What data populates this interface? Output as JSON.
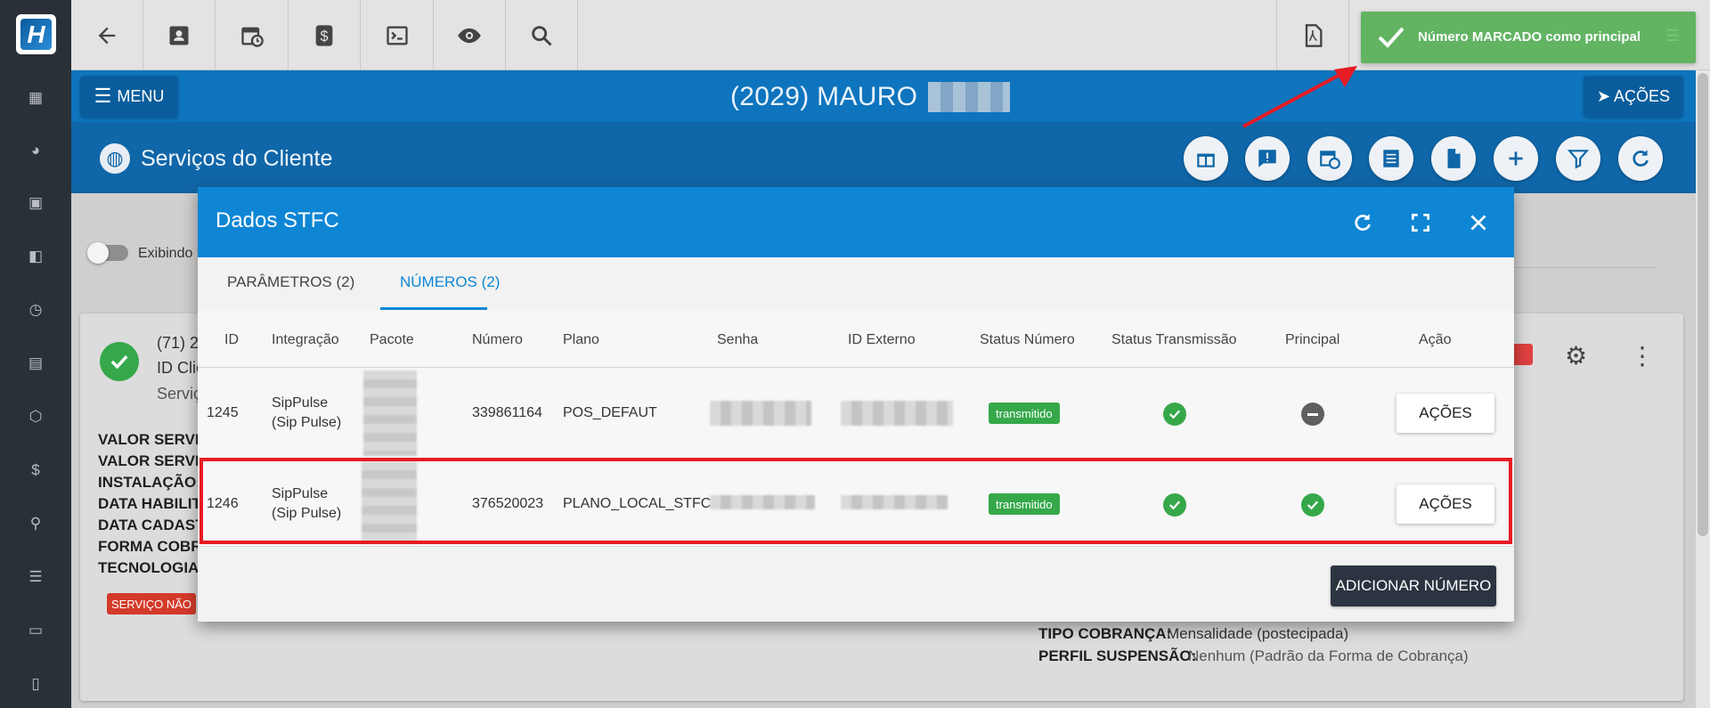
{
  "app": {
    "logo_letter": "H",
    "toolbar_icons": [
      "back-arrow-icon",
      "contact-card-icon",
      "calendar-clock-icon",
      "dollar-icon",
      "terminal-icon",
      "eye-icon",
      "search-icon",
      "pdf-icon"
    ],
    "rail_icons": [
      "dashboard-icon",
      "pie-chart-icon",
      "contact-icon",
      "layout-icon",
      "calendar-icon",
      "badge-icon",
      "package-icon",
      "money-icon",
      "map-pin-icon",
      "document-icon",
      "server-icon",
      "file-icon"
    ]
  },
  "header": {
    "menu_label": "MENU",
    "client_title": "(2029) MAURO",
    "acoes_label": "AÇÕES"
  },
  "services_bar": {
    "title": "Serviços do Cliente",
    "action_icons": [
      "gift-icon",
      "alert-chat-icon",
      "calendar-clock-icon",
      "list-icon",
      "document-icon",
      "plus-icon",
      "filter-icon",
      "refresh-icon"
    ]
  },
  "background": {
    "toggle_label": "Exibindo",
    "card": {
      "phone_prefix": "(71) 2",
      "id_label": "ID Clie",
      "service_label": "Serviç",
      "fields": [
        "VALOR SERVIC",
        "VALOR SERVIC",
        "INSTALAÇÃO:",
        "DATA HABILIT",
        "DATA CADAST",
        "FORMA COBRA",
        "TECNOLOGIA"
      ],
      "badge": "SERVIÇO NÃO",
      "tipo_cobranca_label": "TIPO COBRANÇA:",
      "tipo_cobranca_value": "Mensalidade (postecipada)",
      "perfil_label": "PERFIL SUSPENSÃO:",
      "perfil_value": "Nenhum (Padrão da Forma de Cobrança)"
    }
  },
  "modal": {
    "title": "Dados STFC",
    "tabs": [
      {
        "label": "PARÂMETROS (2)",
        "active": false
      },
      {
        "label": "NÚMEROS (2)",
        "active": true
      }
    ],
    "columns": [
      "ID",
      "Integração",
      "Pacote",
      "Número",
      "Plano",
      "Senha",
      "ID Externo",
      "Status Número",
      "Status Transmissão",
      "Principal",
      "Ação"
    ],
    "rows": [
      {
        "id": "1245",
        "integracao_1": "SipPulse",
        "integracao_2": "(Sip Pulse)",
        "numero": "339861164",
        "plano": "POS_DEFAUT",
        "status_numero": "transmitido",
        "status_transmissao": "ok",
        "principal": "no",
        "acao": "AÇÕES"
      },
      {
        "id": "1246",
        "integracao_1": "SipPulse",
        "integracao_2": "(Sip Pulse)",
        "numero": "376520023",
        "plano": "PLANO_LOCAL_STFC",
        "status_numero": "transmitido",
        "status_transmissao": "ok",
        "principal": "yes",
        "acao": "AÇÕES"
      }
    ],
    "add_button": "ADICIONAR NÚMERO"
  },
  "toast": {
    "message": "Número MARCADO como principal"
  },
  "colors": {
    "blue_header": "#0e74bd",
    "modal_header": "#0e86d4",
    "success": "#36a84a",
    "highlight_border": "#e61b23",
    "toast": "#5cb25d"
  }
}
